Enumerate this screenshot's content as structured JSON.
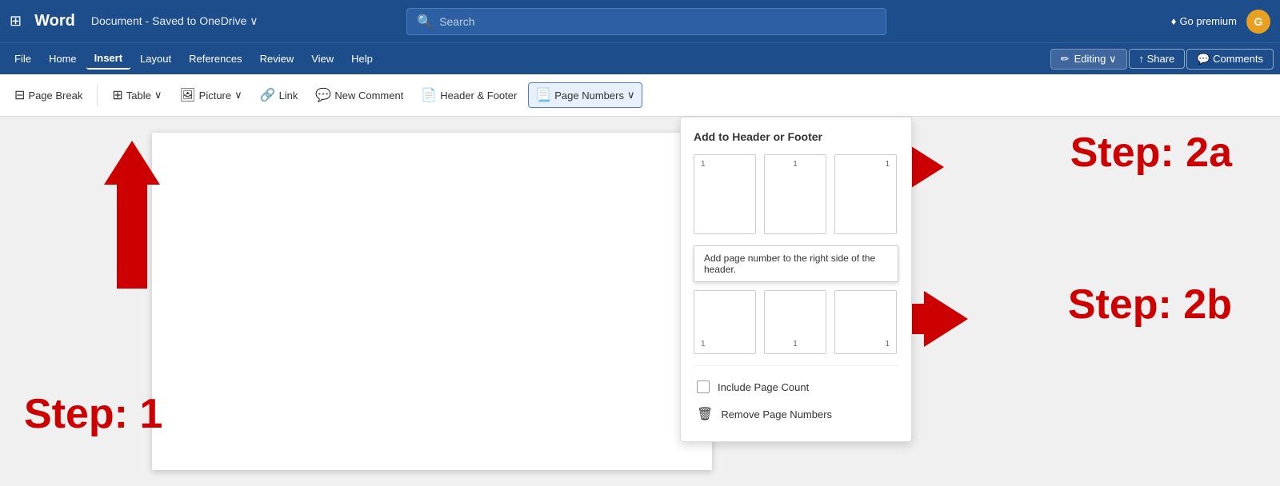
{
  "titlebar": {
    "grid_icon": "⊞",
    "app_name": "Word",
    "doc_title": "Document - Saved to OneDrive ∨",
    "search_placeholder": "Search",
    "go_premium": "Go premium",
    "user_initial": "G"
  },
  "menubar": {
    "items": [
      "File",
      "Home",
      "Insert",
      "Layout",
      "References",
      "Review",
      "View",
      "Help"
    ],
    "active_index": 2,
    "editing_label": "✏ Editing ∨",
    "share_label": "Share",
    "comments_label": "Comments"
  },
  "toolbar": {
    "page_break": "Page Break",
    "table": "Table",
    "picture": "Picture",
    "link": "Link",
    "new_comment": "New Comment",
    "header_footer": "Header & Footer",
    "page_numbers": "Page Numbers"
  },
  "dropdown": {
    "title": "Add to Header or Footer",
    "tooltip": "Add page number to the right side of the header.",
    "include_page_count": "Include Page Count",
    "remove_page_numbers": "Remove Page Numbers",
    "row1": [
      {
        "position": "left",
        "num": "1"
      },
      {
        "position": "center",
        "num": "1"
      },
      {
        "position": "right",
        "num": "1"
      }
    ],
    "row2": [
      {
        "position": "left",
        "num": "1"
      },
      {
        "position": "center",
        "num": "1"
      },
      {
        "position": "right",
        "num": "1"
      }
    ]
  },
  "steps": {
    "step1": "Step: 1",
    "step2a": "Step: 2a",
    "step2b": "Step: 2b"
  }
}
